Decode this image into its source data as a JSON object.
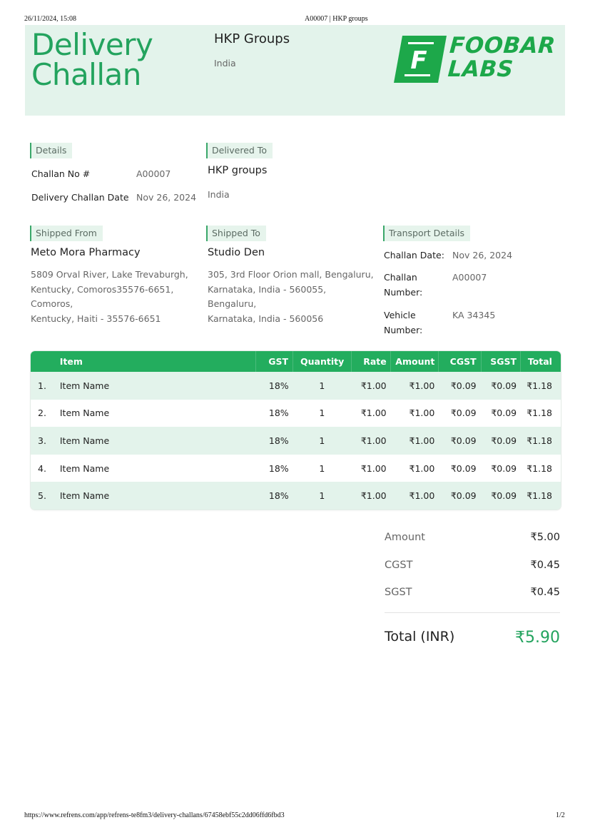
{
  "print_header": {
    "datetime": "26/11/2024, 15:08",
    "title": "A00007 | HKP groups"
  },
  "print_footer": {
    "url": "https://www.refrens.com/app/refrens-te8fm3/delivery-challans/67458ebf55c2dd06ffd6fbd3",
    "page": "1/2"
  },
  "colors": {
    "accent": "#23a35e",
    "header_bg": "#e3f3eb",
    "table_header": "#23ad5e",
    "logo_green": "#1da84a"
  },
  "header": {
    "title_line1": "Delivery",
    "title_line2": "Challan",
    "company_name": "HKP Groups",
    "company_country": "India",
    "logo": {
      "icon": "foobar-f-logo-icon",
      "line1": "FOOBAR",
      "line2": "LABS",
      "letter": "F"
    }
  },
  "details": {
    "tag": "Details",
    "challan_no_label": "Challan No #",
    "challan_no": "A00007",
    "date_label": "Delivery Challan Date",
    "date": "Nov 26, 2024"
  },
  "delivered_to": {
    "tag": "Delivered To",
    "name": "HKP groups",
    "country": "India"
  },
  "shipped_from": {
    "tag": "Shipped From",
    "name": "Meto Mora Pharmacy",
    "address": "5809 Orval River, Lake Trevaburgh,\nKentucky, Comoros35576-6651,\nComoros,\nKentucky, Haiti - 35576-6651"
  },
  "shipped_to": {
    "tag": "Shipped To",
    "name": "Studio Den",
    "address": "305, 3rd Floor Orion mall, Bengaluru,\nKarnataka, India - 560055,\nBengaluru,\nKarnataka, India - 560056"
  },
  "transport": {
    "tag": "Transport Details",
    "challan_date_label": "Challan Date:",
    "challan_date": "Nov 26, 2024",
    "challan_number_label_1": "Challan",
    "challan_number_label_2": "Number:",
    "challan_number": "A00007",
    "vehicle_label_1": "Vehicle",
    "vehicle_label_2": "Number:",
    "vehicle_number": "KA 34345"
  },
  "table": {
    "columns": [
      "",
      "Item",
      "GST",
      "Quantity",
      "Rate",
      "Amount",
      "CGST",
      "SGST",
      "Total"
    ],
    "rows": [
      {
        "num": "1.",
        "item": "Item Name",
        "gst": "18%",
        "qty": "1",
        "rate": "₹1.00",
        "amount": "₹1.00",
        "cgst": "₹0.09",
        "sgst": "₹0.09",
        "total": "₹1.18"
      },
      {
        "num": "2.",
        "item": "Item Name",
        "gst": "18%",
        "qty": "1",
        "rate": "₹1.00",
        "amount": "₹1.00",
        "cgst": "₹0.09",
        "sgst": "₹0.09",
        "total": "₹1.18"
      },
      {
        "num": "3.",
        "item": "Item Name",
        "gst": "18%",
        "qty": "1",
        "rate": "₹1.00",
        "amount": "₹1.00",
        "cgst": "₹0.09",
        "sgst": "₹0.09",
        "total": "₹1.18"
      },
      {
        "num": "4.",
        "item": "Item Name",
        "gst": "18%",
        "qty": "1",
        "rate": "₹1.00",
        "amount": "₹1.00",
        "cgst": "₹0.09",
        "sgst": "₹0.09",
        "total": "₹1.18"
      },
      {
        "num": "5.",
        "item": "Item Name",
        "gst": "18%",
        "qty": "1",
        "rate": "₹1.00",
        "amount": "₹1.00",
        "cgst": "₹0.09",
        "sgst": "₹0.09",
        "total": "₹1.18"
      }
    ]
  },
  "summary": {
    "amount_label": "Amount",
    "amount": "₹5.00",
    "cgst_label": "CGST",
    "cgst": "₹0.45",
    "sgst_label": "SGST",
    "sgst": "₹0.45",
    "total_label": "Total (INR)",
    "total": "₹5.90"
  }
}
